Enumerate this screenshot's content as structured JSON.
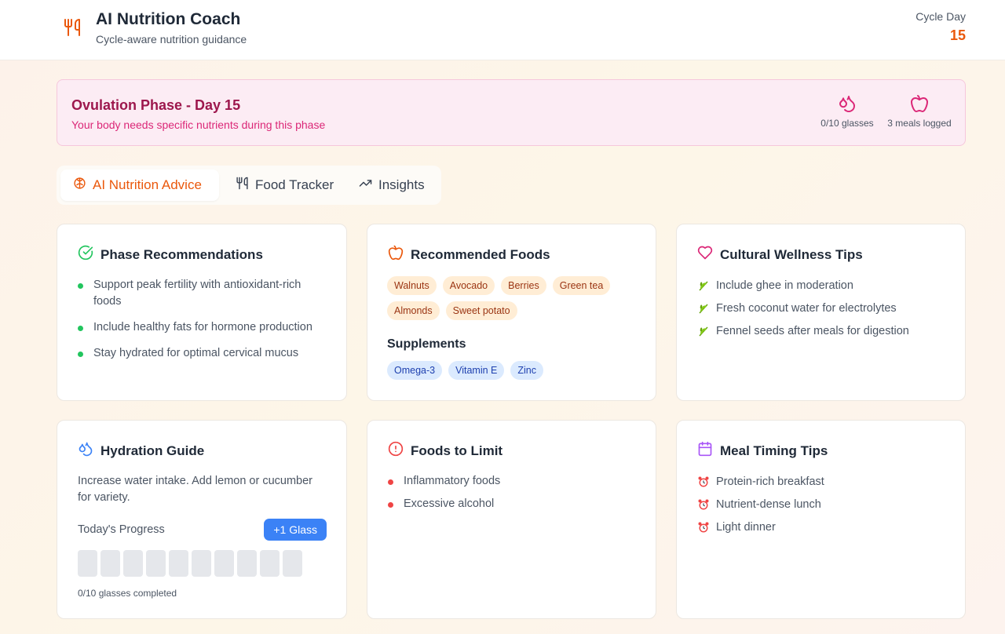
{
  "header": {
    "logo_icon": "utensils-icon",
    "title": "AI Nutrition Coach",
    "subtitle": "Cycle-aware nutrition guidance",
    "cycle_label": "Cycle Day",
    "cycle_value": "15"
  },
  "phase": {
    "title": "Ovulation Phase - Day 15",
    "subtitle": "Your body needs specific nutrients during this phase",
    "water_label": "0/10 glasses",
    "meals_label": "3 meals logged"
  },
  "tabs": [
    {
      "label": "AI Nutrition Advice",
      "icon": "brain-icon",
      "active": true
    },
    {
      "label": "Food Tracker",
      "icon": "utensils-icon",
      "active": false
    },
    {
      "label": "Insights",
      "icon": "trending-up-icon",
      "active": false
    }
  ],
  "recommendations": {
    "title": "Phase Recommendations",
    "items": [
      "Support peak fertility with antioxidant-rich foods",
      "Include healthy fats for hormone production",
      "Stay hydrated for optimal cervical mucus"
    ]
  },
  "foods": {
    "title": "Recommended Foods",
    "items": [
      "Walnuts",
      "Avocado",
      "Berries",
      "Green tea",
      "Almonds",
      "Sweet potato"
    ],
    "supplements_title": "Supplements",
    "supplements": [
      "Omega-3",
      "Vitamin E",
      "Zinc"
    ]
  },
  "cultural": {
    "title": "Cultural Wellness Tips",
    "items": [
      "Include ghee in moderation",
      "Fresh coconut water for electrolytes",
      "Fennel seeds after meals for digestion"
    ]
  },
  "hydration": {
    "title": "Hydration Guide",
    "text": "Increase water intake. Add lemon or cucumber for variety.",
    "progress_label": "Today's Progress",
    "button_label": "+1 Glass",
    "glasses_filled": 0,
    "glasses_total": 10,
    "count_label": "0/10 glasses completed"
  },
  "limit": {
    "title": "Foods to Limit",
    "items": [
      "Inflammatory foods",
      "Excessive alcohol"
    ]
  },
  "timing": {
    "title": "Meal Timing Tips",
    "items": [
      "Protein-rich breakfast",
      "Nutrient-dense lunch",
      "Light dinner"
    ]
  },
  "colors": {
    "accent": "#ea580c",
    "phase_text": "#9d174d",
    "phase_bg": "#fcecf4",
    "primary_button": "#3b82f6"
  }
}
